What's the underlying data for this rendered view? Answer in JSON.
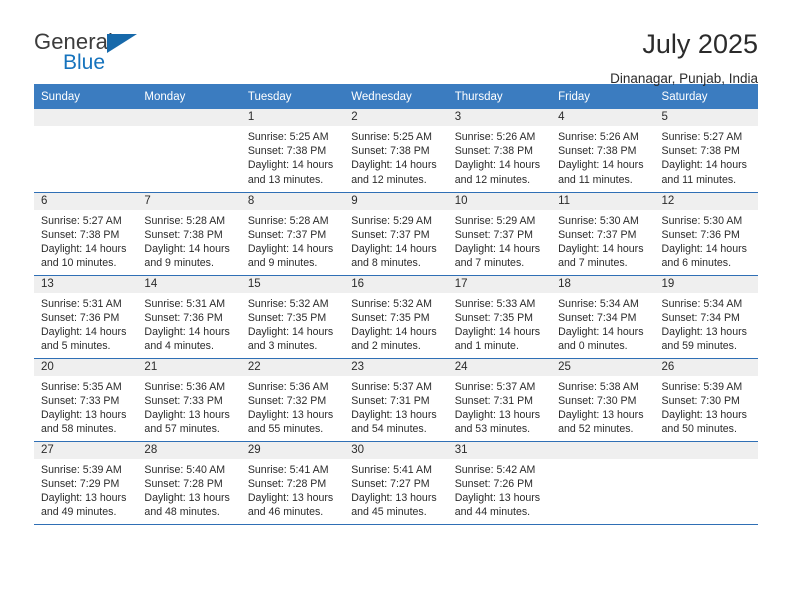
{
  "brand": {
    "name_top": "General",
    "name_bottom": "Blue",
    "accent_color": "#1769aa"
  },
  "header": {
    "title": "July 2025",
    "subtitle": "Dinanagar, Punjab, India"
  },
  "theme": {
    "header_bg": "#3b7cc0",
    "header_text": "#ffffff",
    "row_divider": "#2f6fb5",
    "daynum_band": "#efefef"
  },
  "weekdays": [
    "Sunday",
    "Monday",
    "Tuesday",
    "Wednesday",
    "Thursday",
    "Friday",
    "Saturday"
  ],
  "weeks": [
    [
      {
        "day": "",
        "sunrise": "",
        "sunset": "",
        "daylight": ""
      },
      {
        "day": "",
        "sunrise": "",
        "sunset": "",
        "daylight": ""
      },
      {
        "day": "1",
        "sunrise": "Sunrise: 5:25 AM",
        "sunset": "Sunset: 7:38 PM",
        "daylight": "Daylight: 14 hours and 13 minutes."
      },
      {
        "day": "2",
        "sunrise": "Sunrise: 5:25 AM",
        "sunset": "Sunset: 7:38 PM",
        "daylight": "Daylight: 14 hours and 12 minutes."
      },
      {
        "day": "3",
        "sunrise": "Sunrise: 5:26 AM",
        "sunset": "Sunset: 7:38 PM",
        "daylight": "Daylight: 14 hours and 12 minutes."
      },
      {
        "day": "4",
        "sunrise": "Sunrise: 5:26 AM",
        "sunset": "Sunset: 7:38 PM",
        "daylight": "Daylight: 14 hours and 11 minutes."
      },
      {
        "day": "5",
        "sunrise": "Sunrise: 5:27 AM",
        "sunset": "Sunset: 7:38 PM",
        "daylight": "Daylight: 14 hours and 11 minutes."
      }
    ],
    [
      {
        "day": "6",
        "sunrise": "Sunrise: 5:27 AM",
        "sunset": "Sunset: 7:38 PM",
        "daylight": "Daylight: 14 hours and 10 minutes."
      },
      {
        "day": "7",
        "sunrise": "Sunrise: 5:28 AM",
        "sunset": "Sunset: 7:38 PM",
        "daylight": "Daylight: 14 hours and 9 minutes."
      },
      {
        "day": "8",
        "sunrise": "Sunrise: 5:28 AM",
        "sunset": "Sunset: 7:37 PM",
        "daylight": "Daylight: 14 hours and 9 minutes."
      },
      {
        "day": "9",
        "sunrise": "Sunrise: 5:29 AM",
        "sunset": "Sunset: 7:37 PM",
        "daylight": "Daylight: 14 hours and 8 minutes."
      },
      {
        "day": "10",
        "sunrise": "Sunrise: 5:29 AM",
        "sunset": "Sunset: 7:37 PM",
        "daylight": "Daylight: 14 hours and 7 minutes."
      },
      {
        "day": "11",
        "sunrise": "Sunrise: 5:30 AM",
        "sunset": "Sunset: 7:37 PM",
        "daylight": "Daylight: 14 hours and 7 minutes."
      },
      {
        "day": "12",
        "sunrise": "Sunrise: 5:30 AM",
        "sunset": "Sunset: 7:36 PM",
        "daylight": "Daylight: 14 hours and 6 minutes."
      }
    ],
    [
      {
        "day": "13",
        "sunrise": "Sunrise: 5:31 AM",
        "sunset": "Sunset: 7:36 PM",
        "daylight": "Daylight: 14 hours and 5 minutes."
      },
      {
        "day": "14",
        "sunrise": "Sunrise: 5:31 AM",
        "sunset": "Sunset: 7:36 PM",
        "daylight": "Daylight: 14 hours and 4 minutes."
      },
      {
        "day": "15",
        "sunrise": "Sunrise: 5:32 AM",
        "sunset": "Sunset: 7:35 PM",
        "daylight": "Daylight: 14 hours and 3 minutes."
      },
      {
        "day": "16",
        "sunrise": "Sunrise: 5:32 AM",
        "sunset": "Sunset: 7:35 PM",
        "daylight": "Daylight: 14 hours and 2 minutes."
      },
      {
        "day": "17",
        "sunrise": "Sunrise: 5:33 AM",
        "sunset": "Sunset: 7:35 PM",
        "daylight": "Daylight: 14 hours and 1 minute."
      },
      {
        "day": "18",
        "sunrise": "Sunrise: 5:34 AM",
        "sunset": "Sunset: 7:34 PM",
        "daylight": "Daylight: 14 hours and 0 minutes."
      },
      {
        "day": "19",
        "sunrise": "Sunrise: 5:34 AM",
        "sunset": "Sunset: 7:34 PM",
        "daylight": "Daylight: 13 hours and 59 minutes."
      }
    ],
    [
      {
        "day": "20",
        "sunrise": "Sunrise: 5:35 AM",
        "sunset": "Sunset: 7:33 PM",
        "daylight": "Daylight: 13 hours and 58 minutes."
      },
      {
        "day": "21",
        "sunrise": "Sunrise: 5:36 AM",
        "sunset": "Sunset: 7:33 PM",
        "daylight": "Daylight: 13 hours and 57 minutes."
      },
      {
        "day": "22",
        "sunrise": "Sunrise: 5:36 AM",
        "sunset": "Sunset: 7:32 PM",
        "daylight": "Daylight: 13 hours and 55 minutes."
      },
      {
        "day": "23",
        "sunrise": "Sunrise: 5:37 AM",
        "sunset": "Sunset: 7:31 PM",
        "daylight": "Daylight: 13 hours and 54 minutes."
      },
      {
        "day": "24",
        "sunrise": "Sunrise: 5:37 AM",
        "sunset": "Sunset: 7:31 PM",
        "daylight": "Daylight: 13 hours and 53 minutes."
      },
      {
        "day": "25",
        "sunrise": "Sunrise: 5:38 AM",
        "sunset": "Sunset: 7:30 PM",
        "daylight": "Daylight: 13 hours and 52 minutes."
      },
      {
        "day": "26",
        "sunrise": "Sunrise: 5:39 AM",
        "sunset": "Sunset: 7:30 PM",
        "daylight": "Daylight: 13 hours and 50 minutes."
      }
    ],
    [
      {
        "day": "27",
        "sunrise": "Sunrise: 5:39 AM",
        "sunset": "Sunset: 7:29 PM",
        "daylight": "Daylight: 13 hours and 49 minutes."
      },
      {
        "day": "28",
        "sunrise": "Sunrise: 5:40 AM",
        "sunset": "Sunset: 7:28 PM",
        "daylight": "Daylight: 13 hours and 48 minutes."
      },
      {
        "day": "29",
        "sunrise": "Sunrise: 5:41 AM",
        "sunset": "Sunset: 7:28 PM",
        "daylight": "Daylight: 13 hours and 46 minutes."
      },
      {
        "day": "30",
        "sunrise": "Sunrise: 5:41 AM",
        "sunset": "Sunset: 7:27 PM",
        "daylight": "Daylight: 13 hours and 45 minutes."
      },
      {
        "day": "31",
        "sunrise": "Sunrise: 5:42 AM",
        "sunset": "Sunset: 7:26 PM",
        "daylight": "Daylight: 13 hours and 44 minutes."
      },
      {
        "day": "",
        "sunrise": "",
        "sunset": "",
        "daylight": ""
      },
      {
        "day": "",
        "sunrise": "",
        "sunset": "",
        "daylight": ""
      }
    ]
  ]
}
